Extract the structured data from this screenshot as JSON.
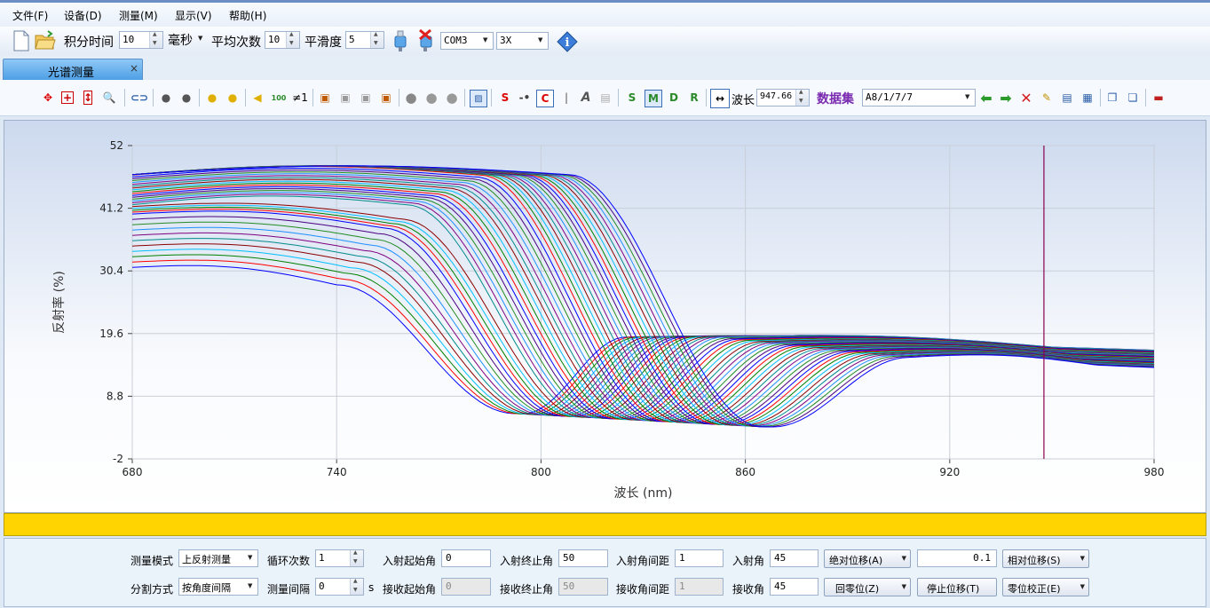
{
  "menu": [
    "文件(F)",
    "设备(D)",
    "测量(M)",
    "显示(V)",
    "帮助(H)"
  ],
  "toolbar": {
    "integration_label": "积分时间",
    "integration_value": "10",
    "integration_unit": "毫秒",
    "average_label": "平均次数",
    "average_value": "10",
    "smooth_label": "平滑度",
    "smooth_value": "5",
    "port_value": "COM3",
    "zoom_value": "3X"
  },
  "tab": {
    "label": "光谱测量",
    "close": "×"
  },
  "toolbar2": {
    "wavelength_label": "波长",
    "wavelength_value": "947.66",
    "dataset_label": "数据集",
    "dataset_value": "A8/1/7/7",
    "mode_letters": [
      "S",
      "M",
      "D",
      "R"
    ],
    "s_letter": "S",
    "c_letter": "C",
    "neq_label": "≠1",
    "num_label": "100"
  },
  "chart_data": {
    "type": "line",
    "xlabel": "波长 (nm)",
    "ylabel": "反射率 (%)",
    "xlim": [
      680,
      980
    ],
    "ylim": [
      -2,
      52
    ],
    "xticks": [
      "680",
      "740",
      "800",
      "860",
      "920",
      "980"
    ],
    "yticks": [
      "52",
      "41.2",
      "30.4",
      "19.6",
      "8.8",
      "-2"
    ],
    "cursor_x": 947.66,
    "grid": true,
    "series_count": 51,
    "series_colors": [
      "#0000ff",
      "#ff0000",
      "#008000",
      "#00bfff",
      "#8b0000",
      "#008b8b",
      "#800080",
      "#1e90ff",
      "#228b22",
      "#4b0082"
    ],
    "dip_first_nm": 795,
    "dip_last_nm": 868,
    "dip_first_value": 5.8,
    "dip_last_value": 3.5
  },
  "form": {
    "mode_label": "测量模式",
    "mode_value": "上反射测量",
    "cycles_label": "循环次数",
    "cycles_value": "1",
    "start_in_label": "入射起始角",
    "start_in_value": "0",
    "end_in_label": "入射终止角",
    "end_in_value": "50",
    "step_in_label": "入射角间距",
    "step_in_value": "1",
    "incident_label": "入射角",
    "incident_value": "45",
    "abs_move": "绝对位移(A)",
    "move_value": "0.1",
    "rel_move": "相对位移(S)",
    "split_label": "分割方式",
    "split_value": "按角度间隔",
    "interval_label": "测量间隔",
    "interval_value": "0",
    "interval_unit": "s",
    "start_rx_label": "接收起始角",
    "start_rx_value": "0",
    "end_rx_label": "接收终止角",
    "end_rx_value": "50",
    "step_rx_label": "接收角间距",
    "step_rx_value": "1",
    "receive_label": "接收角",
    "receive_value": "45",
    "home": "回零位(Z)",
    "stop": "停止位移(T)",
    "zero_cal": "零位校正(E)"
  }
}
